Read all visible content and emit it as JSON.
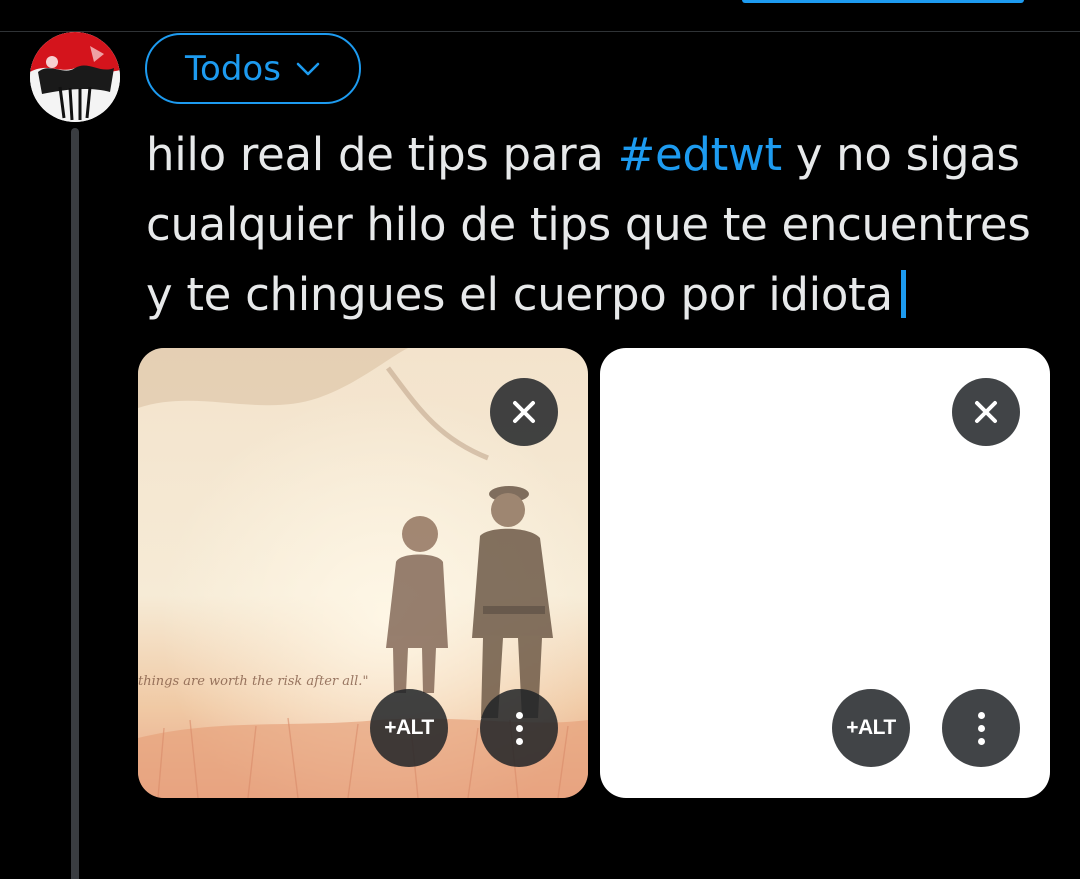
{
  "header": {
    "active_tab_color": "#1d9bf0"
  },
  "composer": {
    "audience_label": "Todos",
    "audience_icon": "chevron-down-icon",
    "text_plain_1": "hilo real de tips para ",
    "hashtag": "#edtwt",
    "text_plain_2": " y no sigas cualquier hilo de tips que te encuentres y te chingues el cuerpo por idiota"
  },
  "media": [
    {
      "kind": "illustration",
      "overlay_text": "things are worth the risk after all.\"",
      "close_icon": "close-icon",
      "alt_label": "+ALT",
      "more_icon": "more-vertical-icon"
    },
    {
      "kind": "blank-white-image",
      "close_icon": "close-icon",
      "alt_label": "+ALT",
      "more_icon": "more-vertical-icon"
    }
  ],
  "colors": {
    "background": "#000000",
    "accent": "#1d9bf0",
    "text": "#e7e9ea",
    "thread_line": "#3a3d41"
  }
}
